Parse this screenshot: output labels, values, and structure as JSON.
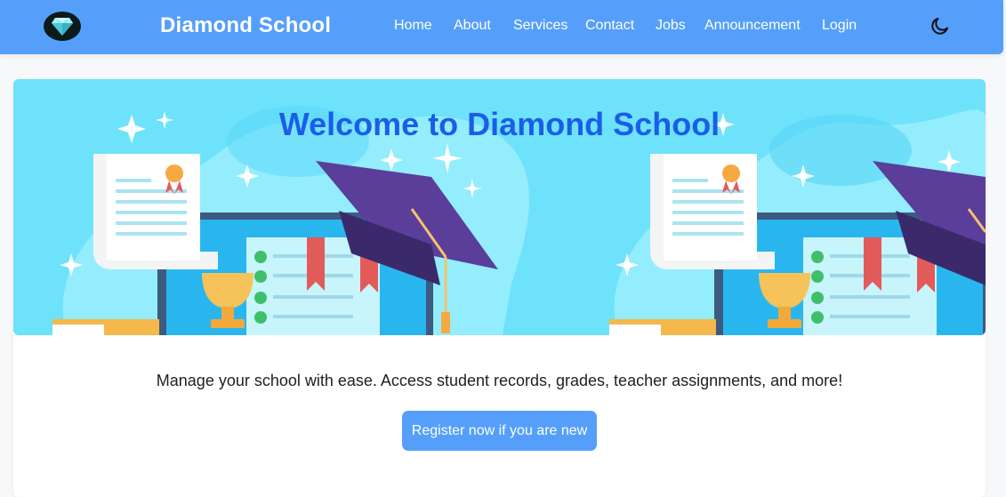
{
  "header": {
    "brand": "Diamond School",
    "logo_icon": "diamond-icon",
    "nav": [
      {
        "label": "Home"
      },
      {
        "label": "About"
      },
      {
        "label": "Services"
      },
      {
        "label": "Contact"
      },
      {
        "label": "Jobs"
      },
      {
        "label": "Announcement"
      },
      {
        "label": "Login"
      }
    ],
    "theme_toggle_icon": "moon-icon"
  },
  "hero": {
    "title": "Welcome to Diamond School",
    "illustration": "graduation-cap-certificate-trophy-illustration"
  },
  "main": {
    "tagline": "Manage your school with ease. Access student records, grades, teacher assignments, and more!",
    "cta_label": "Register now if you are new"
  },
  "colors": {
    "navbar": "#559ffb",
    "hero_bg": "#6ee2fb",
    "hero_title": "#1a5ee8",
    "button": "#559ffb"
  }
}
